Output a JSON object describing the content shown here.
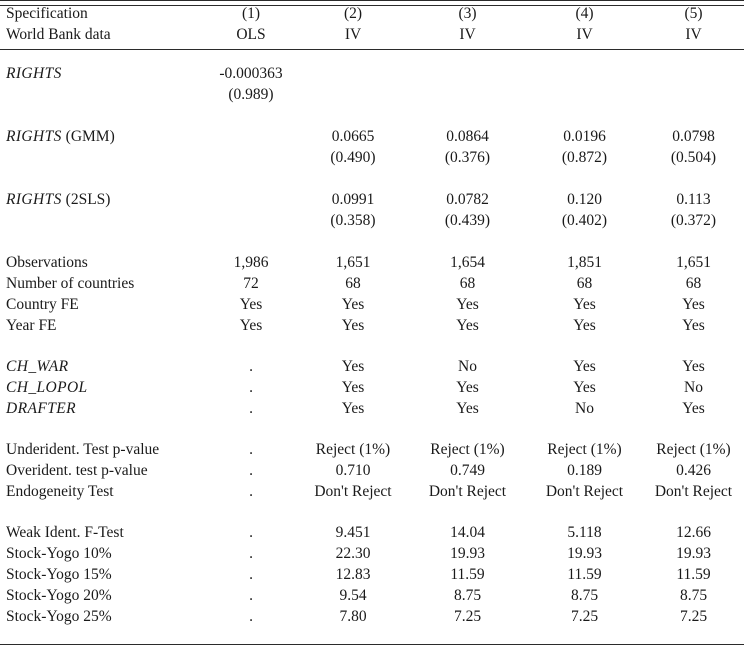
{
  "table": {
    "header": {
      "row1_label": "Specification",
      "row1_values": [
        "(1)",
        "(2)",
        "(3)",
        "(4)",
        "(5)"
      ],
      "row2_label": "World Bank data",
      "row2_values": [
        "OLS",
        "IV",
        "IV",
        "IV",
        "IV"
      ]
    },
    "blocks": [
      {
        "name": "rights-ols",
        "rows": [
          {
            "label_italic": "RIGHTS",
            "label_upright": "",
            "type": "coef",
            "values": [
              "-0.000363",
              "",
              "",
              "",
              ""
            ]
          },
          {
            "label_italic": "",
            "label_upright": "",
            "type": "se",
            "values": [
              "(0.989)",
              "",
              "",
              "",
              ""
            ]
          }
        ]
      },
      {
        "name": "rights-gmm",
        "rows": [
          {
            "label_italic": "RIGHTS",
            "label_upright": " (GMM)",
            "type": "coef",
            "values": [
              "",
              "0.0665",
              "0.0864",
              "0.0196",
              "0.0798"
            ]
          },
          {
            "label_italic": "",
            "label_upright": "",
            "type": "se",
            "values": [
              "",
              "(0.490)",
              "(0.376)",
              "(0.872)",
              "(0.504)"
            ]
          }
        ]
      },
      {
        "name": "rights-2sls",
        "rows": [
          {
            "label_italic": "RIGHTS",
            "label_upright": " (2SLS)",
            "type": "coef",
            "values": [
              "",
              "0.0991",
              "0.0782",
              "0.120",
              "0.113"
            ]
          },
          {
            "label_italic": "",
            "label_upright": "",
            "type": "se",
            "values": [
              "",
              "(0.358)",
              "(0.439)",
              "(0.402)",
              "(0.372)"
            ]
          }
        ]
      },
      {
        "name": "sample-and-fe",
        "rows": [
          {
            "label_italic": "",
            "label_upright": "Observations",
            "type": "stat",
            "values": [
              "1,986",
              "1,651",
              "1,654",
              "1,851",
              "1,651"
            ]
          },
          {
            "label_italic": "",
            "label_upright": "Number of countries",
            "type": "stat",
            "values": [
              "72",
              "68",
              "68",
              "68",
              "68"
            ]
          },
          {
            "label_italic": "",
            "label_upright": "Country FE",
            "type": "stat",
            "values": [
              "Yes",
              "Yes",
              "Yes",
              "Yes",
              "Yes"
            ]
          },
          {
            "label_italic": "",
            "label_upright": "Year FE",
            "type": "stat",
            "values": [
              "Yes",
              "Yes",
              "Yes",
              "Yes",
              "Yes"
            ]
          }
        ]
      },
      {
        "name": "instruments",
        "rows": [
          {
            "label_italic": "CH_WAR",
            "label_upright": "",
            "type": "stat",
            "values": [
              ".",
              "Yes",
              "No",
              "Yes",
              "Yes"
            ]
          },
          {
            "label_italic": "CH_LOPOL",
            "label_upright": "",
            "type": "stat",
            "values": [
              ".",
              "Yes",
              "Yes",
              "Yes",
              "No"
            ]
          },
          {
            "label_italic": "DRAFTER",
            "label_upright": "",
            "type": "stat",
            "values": [
              ".",
              "Yes",
              "Yes",
              "No",
              "Yes"
            ]
          }
        ]
      },
      {
        "name": "iv-diagnostics",
        "rows": [
          {
            "label_italic": "",
            "label_upright": "Underident. Test p-value",
            "type": "stat",
            "values": [
              ".",
              "Reject (1%)",
              "Reject (1%)",
              "Reject (1%)",
              "Reject (1%)"
            ]
          },
          {
            "label_italic": "",
            "label_upright": "Overident. test p-value",
            "type": "stat",
            "values": [
              ".",
              "0.710",
              "0.749",
              "0.189",
              "0.426"
            ]
          },
          {
            "label_italic": "",
            "label_upright": "Endogeneity Test",
            "type": "stat",
            "values": [
              ".",
              "Don't Reject",
              "Don't Reject",
              "Don't Reject",
              "Don't Reject"
            ]
          }
        ]
      },
      {
        "name": "weak-identification",
        "rows": [
          {
            "label_italic": "",
            "label_upright": "Weak Ident. F-Test",
            "type": "stat",
            "values": [
              ".",
              "9.451",
              "14.04",
              "5.118",
              "12.66"
            ]
          },
          {
            "label_italic": "",
            "label_upright": "Stock-Yogo 10%",
            "type": "stat",
            "values": [
              ".",
              "22.30",
              "19.93",
              "19.93",
              "19.93"
            ]
          },
          {
            "label_italic": "",
            "label_upright": "Stock-Yogo 15%",
            "type": "stat",
            "values": [
              ".",
              "12.83",
              "11.59",
              "11.59",
              "11.59"
            ]
          },
          {
            "label_italic": "",
            "label_upright": "Stock-Yogo 20%",
            "type": "stat",
            "values": [
              ".",
              "9.54",
              "8.75",
              "8.75",
              "8.75"
            ]
          },
          {
            "label_italic": "",
            "label_upright": "Stock-Yogo 25%",
            "type": "stat",
            "values": [
              ".",
              "7.80",
              "7.25",
              "7.25",
              "7.25"
            ]
          }
        ]
      }
    ]
  },
  "colors": {
    "background": "#ffffff",
    "text": "#1a1a1a",
    "rule": "#2b2b2b"
  }
}
